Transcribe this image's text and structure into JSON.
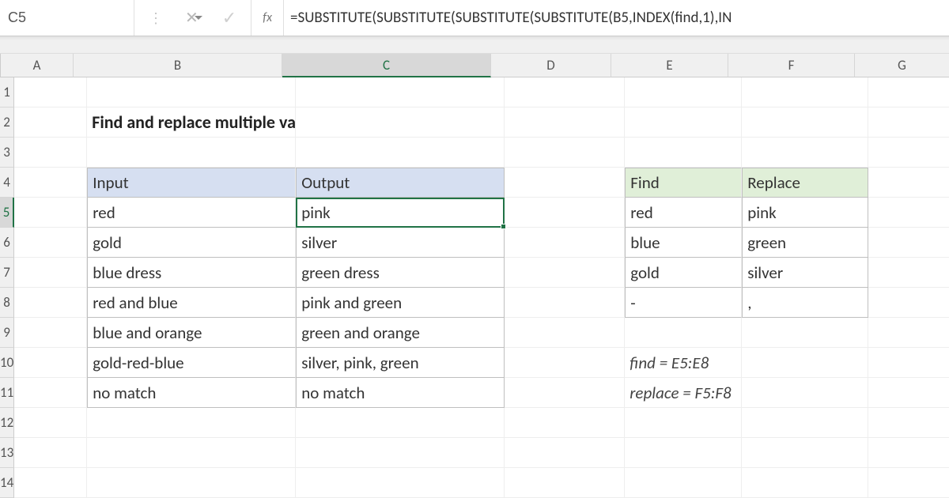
{
  "name_box": "C5",
  "formula": "=SUBSTITUTE(SUBSTITUTE(SUBSTITUTE(SUBSTITUTE(B5,INDEX(find,1),IN",
  "columns": [
    "A",
    "B",
    "C",
    "D",
    "E",
    "F",
    "G"
  ],
  "rows": [
    "1",
    "2",
    "3",
    "4",
    "5",
    "6",
    "7",
    "8",
    "9",
    "10",
    "11",
    "12",
    "13",
    "14"
  ],
  "active": {
    "col": "C",
    "row": "5"
  },
  "title": "Find and replace multiple values",
  "table1": {
    "headers": [
      "Input",
      "Output"
    ],
    "rows": [
      [
        "red",
        "pink"
      ],
      [
        "gold",
        "silver"
      ],
      [
        "blue dress",
        "green dress"
      ],
      [
        "red and blue",
        "pink and green"
      ],
      [
        "blue and orange",
        "green and orange"
      ],
      [
        "gold-red-blue",
        "silver, pink, green"
      ],
      [
        "no match",
        "no match"
      ]
    ]
  },
  "table2": {
    "headers": [
      "Find",
      "Replace"
    ],
    "rows": [
      [
        "red",
        "pink"
      ],
      [
        "blue",
        "green"
      ],
      [
        "gold",
        "silver"
      ],
      [
        "-",
        ","
      ]
    ]
  },
  "notes": {
    "line1": "find = E5:E8",
    "line2": "replace = F5:F8"
  }
}
